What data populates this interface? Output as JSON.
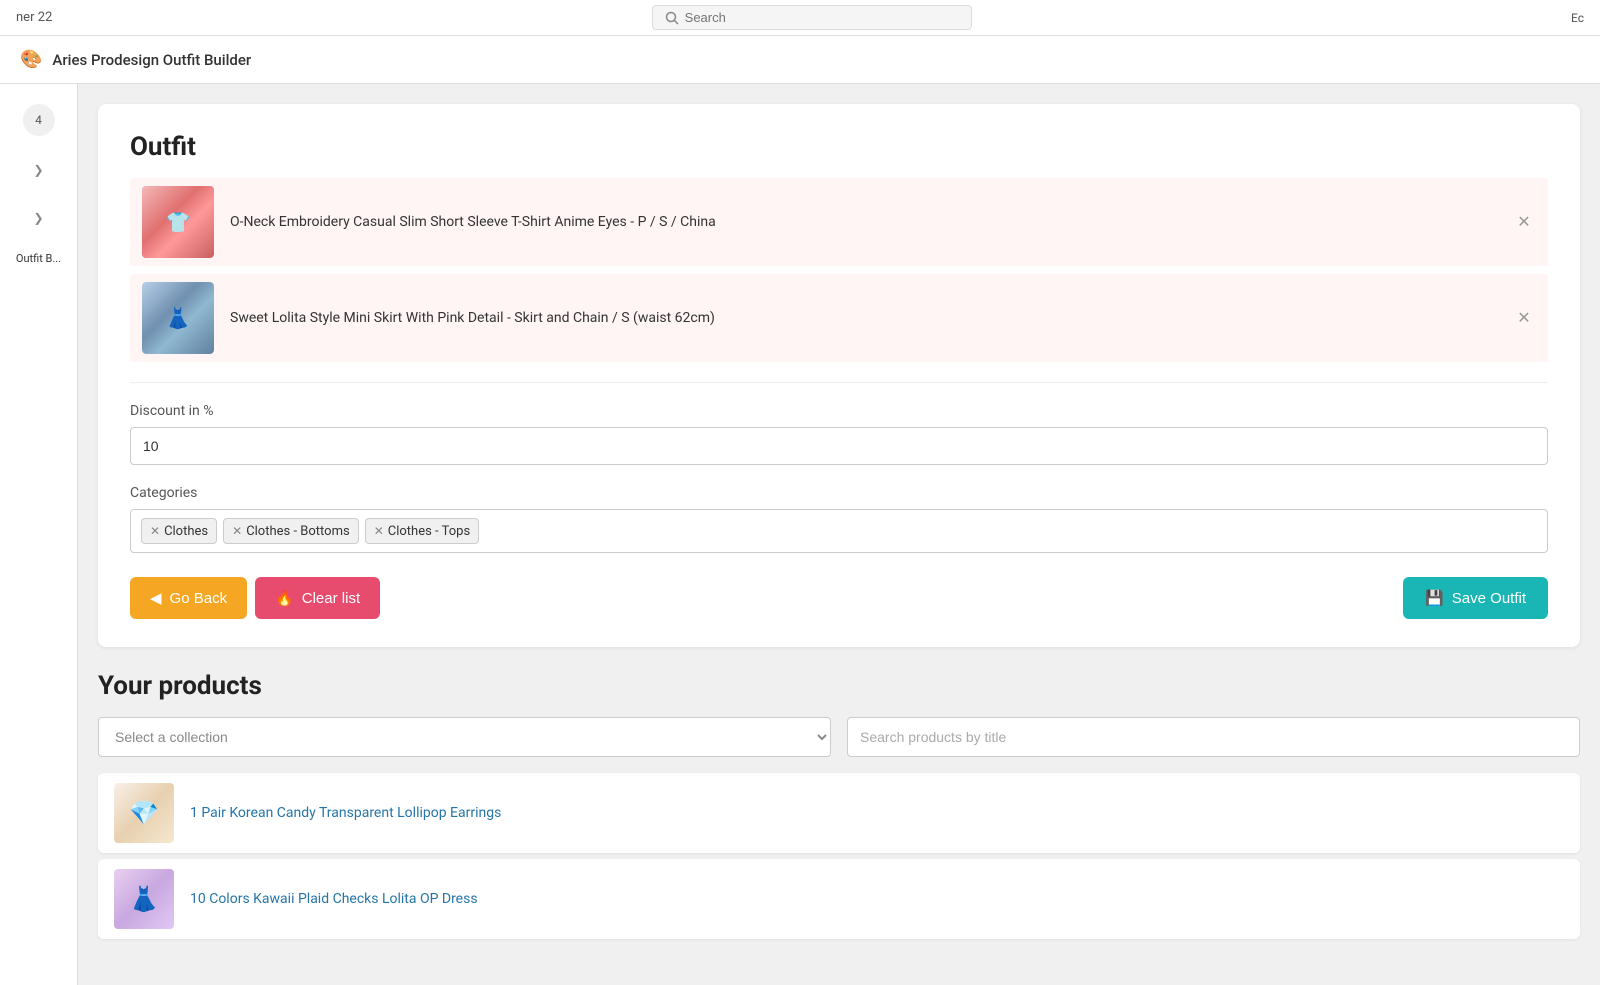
{
  "topbar": {
    "left_text": "ner 22",
    "search_placeholder": "Search",
    "right_text": "Ec"
  },
  "app_header": {
    "logo": "🎨",
    "title": "Aries Prodesign Outfit Builder"
  },
  "sidebar": {
    "badge_number": "4",
    "item_label": "Outfit B..."
  },
  "outfit": {
    "title": "Outfit",
    "products": [
      {
        "name": "O-Neck Embroidery Casual Slim Short Sleeve T-Shirt Anime Eyes - P / S / China",
        "image_class": "img-anime-shirt"
      },
      {
        "name": "Sweet Lolita Style Mini Skirt With Pink Detail - Skirt and Chain / S (waist 62cm)",
        "image_class": "img-lolita-skirt"
      }
    ],
    "discount_label": "Discount in %",
    "discount_value": "10",
    "categories_label": "Categories",
    "categories": [
      {
        "name": "Clothes"
      },
      {
        "name": "Clothes - Bottoms"
      },
      {
        "name": "Clothes - Tops"
      }
    ],
    "go_back_label": "Go Back",
    "clear_list_label": "Clear list",
    "save_outfit_label": "Save Outfit"
  },
  "your_products": {
    "title": "Your products",
    "collection_placeholder": "Select a collection",
    "search_placeholder": "Search products by title",
    "products": [
      {
        "name": "1 Pair Korean Candy Transparent Lollipop Earrings",
        "image_class": "img-earrings"
      },
      {
        "name": "10 Colors Kawaii Plaid Checks Lolita OP Dress",
        "image_class": "img-dress"
      }
    ]
  }
}
